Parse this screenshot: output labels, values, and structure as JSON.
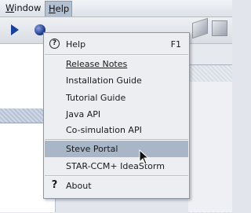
{
  "menubar": {
    "window": "Window",
    "help": "Help"
  },
  "help_menu": {
    "items": [
      {
        "label": "Help",
        "shortcut": "F1",
        "icon": "help-circle-icon"
      },
      {
        "label": "Release Notes"
      },
      {
        "label": "Installation Guide"
      },
      {
        "label": "Tutorial Guide"
      },
      {
        "label": "Java API"
      },
      {
        "label": "Co-simulation API"
      },
      {
        "label": "Steve Portal",
        "highlighted": true
      },
      {
        "label": "STAR-CCM+ IdeaStorm"
      },
      {
        "label": "About",
        "icon": "question-mark-icon"
      }
    ],
    "icon_glyphs": {
      "help": "?",
      "about": "?"
    }
  }
}
